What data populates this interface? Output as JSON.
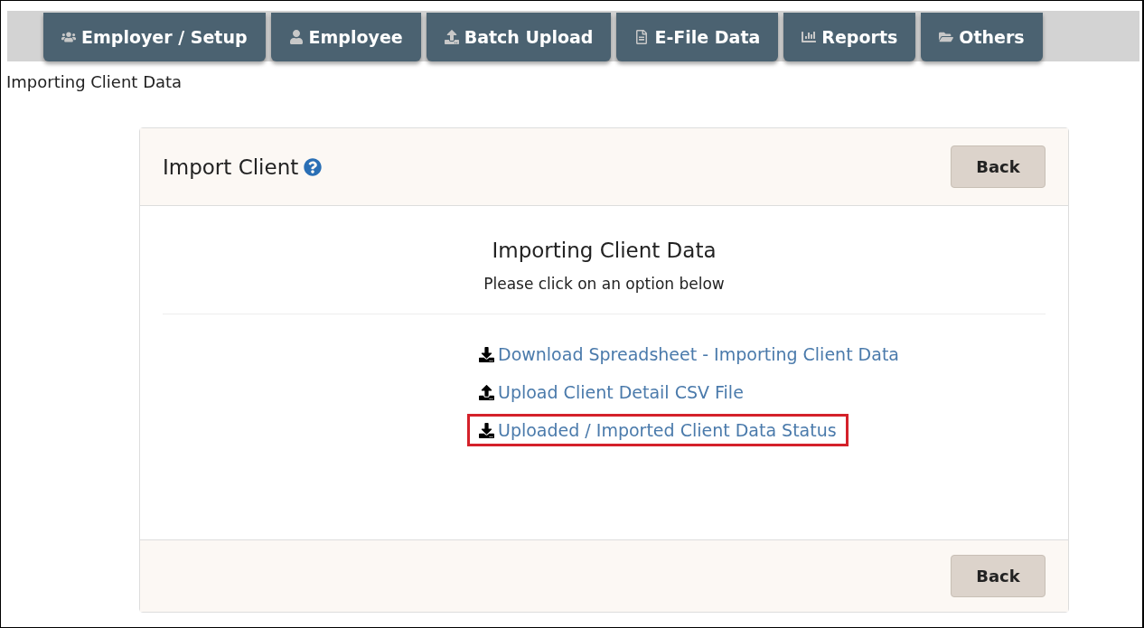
{
  "nav_tabs": [
    {
      "label": "Employer / Setup",
      "kind": "users"
    },
    {
      "label": "Employee",
      "kind": "user"
    },
    {
      "label": "Batch Upload",
      "kind": "upload"
    },
    {
      "label": "E-File Data",
      "kind": "file"
    },
    {
      "label": "Reports",
      "kind": "chart"
    },
    {
      "label": "Others",
      "kind": "folder"
    }
  ],
  "page_title": "Importing Client Data",
  "card": {
    "title": "Import Client",
    "header_button": "Back",
    "heading": "Importing Client Data",
    "subheading": "Please click on an option below",
    "links": [
      {
        "label": "Download Spreadsheet - Importing Client Data",
        "kind": "download",
        "highlighted": false
      },
      {
        "label": "Upload Client Detail CSV File",
        "kind": "upload",
        "highlighted": false
      },
      {
        "label": "Uploaded / Imported Client Data Status",
        "kind": "download",
        "highlighted": true
      }
    ],
    "footer_button": "Back"
  }
}
